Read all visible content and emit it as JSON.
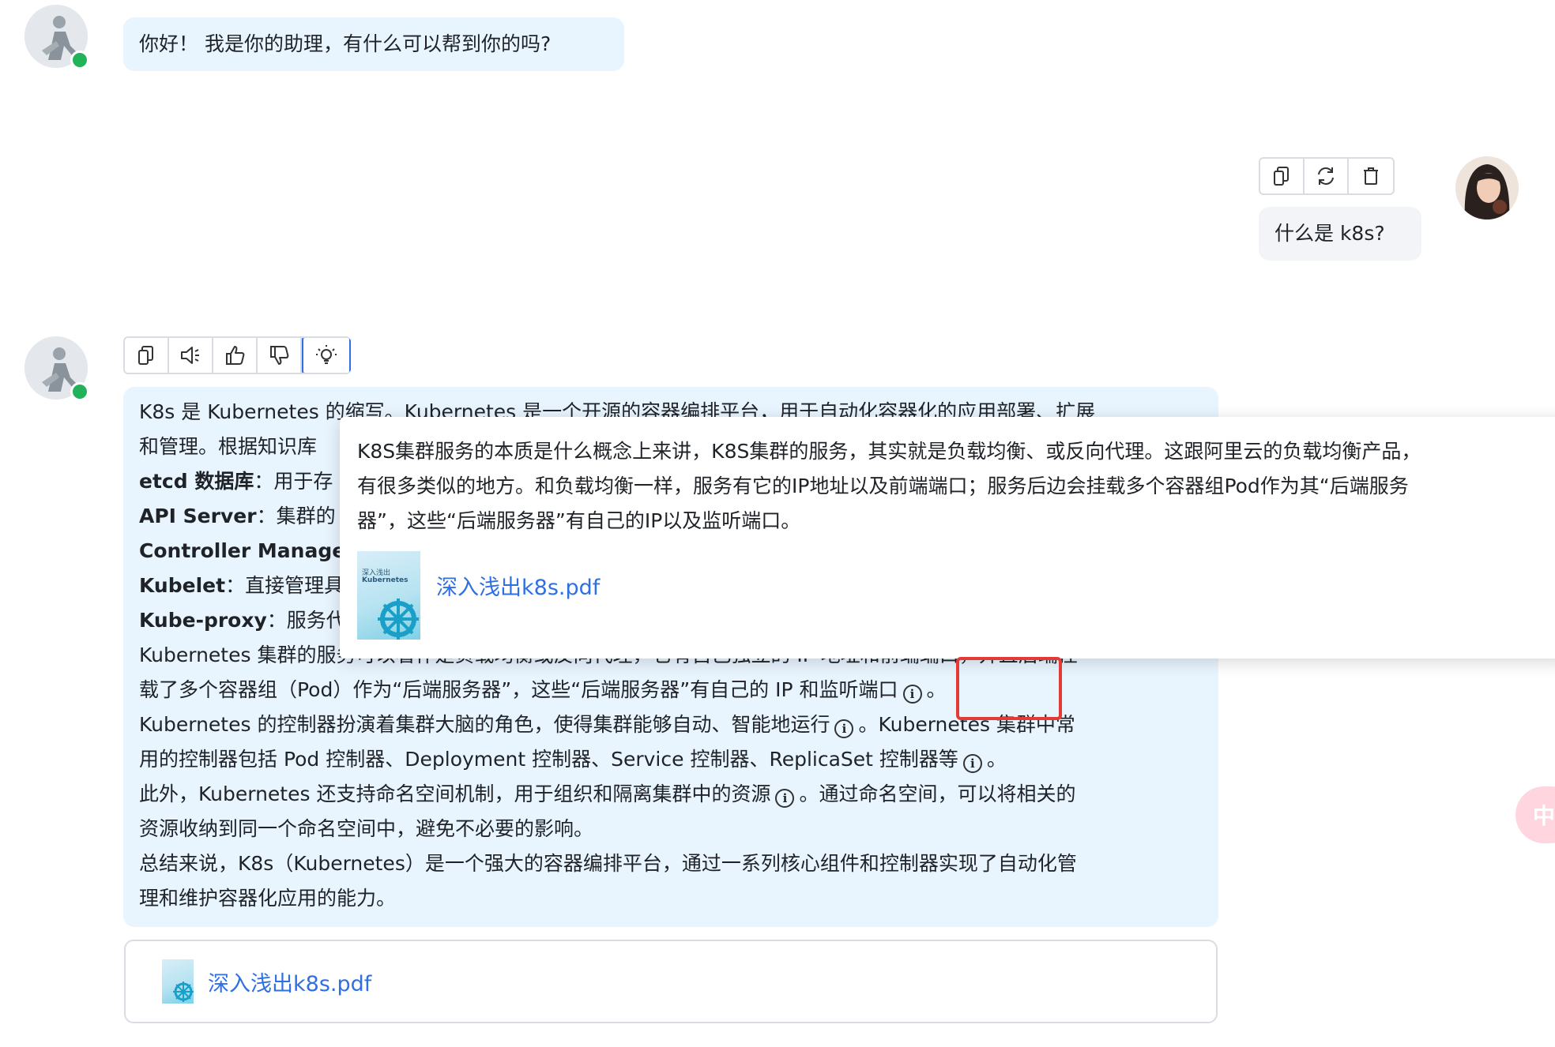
{
  "greeting": {
    "text": "你好！ 我是你的助理，有什么可以帮到你的吗?"
  },
  "user_message": {
    "text": "什么是 k8s?"
  },
  "user_toolbar": [
    "copy-icon",
    "refresh-icon",
    "trash-icon"
  ],
  "answer_toolbar": [
    "copy-icon",
    "speaker-icon",
    "thumbs-up-icon",
    "thumbs-down-icon",
    "lightbulb-icon"
  ],
  "answer": {
    "line1": "K8s 是 Kubernetes 的缩写。Kubernetes 是一个开源的容器编排平台，用于自动化容器化的应用部署、扩展",
    "line2": "和管理。根据知识库",
    "line3_bold": "etcd 数据库",
    "line3": "：用于存",
    "line4_bold": "API Server",
    "line4": "：集群的",
    "line5_bold": "Controller Manage",
    "line6_bold": "Kubelet",
    "line6": "：直接管理具",
    "line7_bold": "Kube-proxy",
    "line7": "：服务代",
    "line8": "Kubernetes 集群的服务可以看作是负载均衡或反向代理，它有自己独立的 IP 地址和前端端口，并且后端挂",
    "line9": "载了多个容器组（Pod）作为“后端服务器”，这些“后端服务器”有自己的 IP 和监听端口",
    "line9_end": "。",
    "line10a": "Kubernetes 的控制器扮演着集群大脑的角色，使得集群能够自动、智能地运行",
    "line10b": "。Kubernetes 集群中常",
    "line11": "用的控制器包括 Pod 控制器、Deployment 控制器、Service 控制器、ReplicaSet 控制器等",
    "line11_end": "。",
    "line12a": "此外，Kubernetes 还支持命名空间机制，用于组织和隔离集群中的资源",
    "line12b": "。通过命名空间，可以将相关的",
    "line13": "资源收纳到同一个命名空间中，避免不必要的影响。",
    "line14": "总结来说，K8s（Kubernetes）是一个强大的容器编排平台，通过一系列核心组件和控制器实现了自动化管",
    "line15": "理和维护容器化应用的能力。"
  },
  "popover": {
    "line1": "K8S集群服务的本质是什么概念上来讲，K8S集群的服务，其实就是负载均衡、或反向代理。这跟阿里云的负载均衡产品，",
    "line2": "有很多类似的地方。和负载均衡一样，服务有它的IP地址以及前端端口；服务后边会挂载多个容器组Pod作为其“后端服务",
    "line3": "器”，这些“后端服务器”有自己的IP以及监听端口。",
    "ref_title": "深入浅出k8s.pdf"
  },
  "reference": {
    "title": "深入浅出k8s.pdf"
  },
  "cover": {
    "title": "深入浅出",
    "subtitle": "Kubernetes"
  },
  "info_icon_glyph": "i",
  "float_button": {
    "label": "中A"
  },
  "colors": {
    "accent": "#2f6fe4",
    "bubble": "#e8f4fe",
    "online": "#22b35a",
    "highlight": "#e53935"
  }
}
